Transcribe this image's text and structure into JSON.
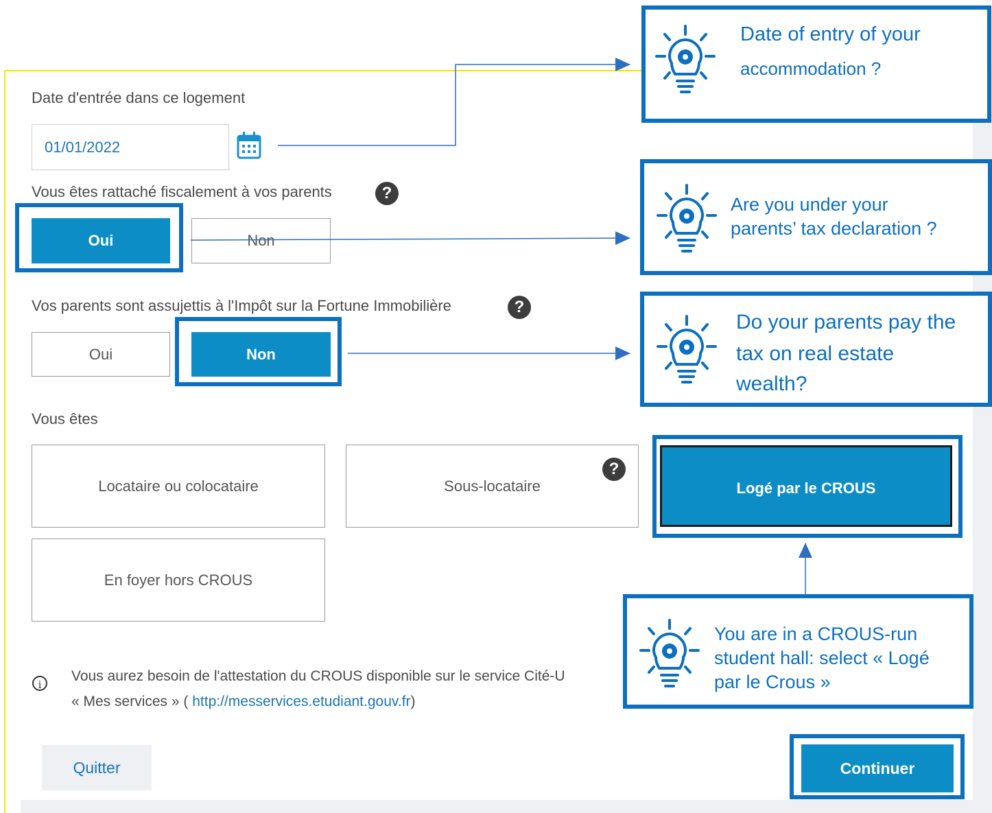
{
  "form": {
    "date_label": "Date d'entrée dans ce logement",
    "date_value": "01/01/2022",
    "tax_label": "Vous êtes rattaché fiscalement à vos parents",
    "tax_yes": "Oui",
    "tax_no": "Non",
    "ifi_label": "Vos parents sont assujettis à l'Impôt sur la Fortune Immobilière",
    "ifi_yes": "Oui",
    "ifi_no": "Non",
    "status_label": "Vous êtes",
    "status_options": [
      "Locataire ou colocataire",
      "Sous-locataire",
      "Logé par le CROUS",
      "En foyer hors CROUS"
    ],
    "help_glyph": "?",
    "info_glyph": "i",
    "info_text_1": "Vous aurez besoin de l'attestation du CROUS disponible sur le service Cité-U",
    "info_text_2_prefix": "« Mes services » (",
    "info_link": "http://messervices.etudiant.gouv.fr",
    "info_text_2_suffix": ")",
    "quit_label": "Quitter",
    "continue_label": "Continuer"
  },
  "callouts": {
    "date": [
      "Date of entry of your",
      "accommodation ?"
    ],
    "tax": [
      "Are you under your",
      "parents’ tax declaration ?"
    ],
    "ifi": [
      "Do your parents pay the",
      "tax on real estate",
      "wealth?"
    ],
    "crous": [
      "You are in a CROUS-run",
      "student hall: select « Logé",
      "par le Crous »"
    ]
  },
  "selected": {
    "tax": "Oui",
    "ifi": "Non",
    "status": "Logé par le CROUS"
  },
  "colors": {
    "primary_blue": "#0c8dc6",
    "annotation_blue": "#0c6fbf",
    "link_blue": "#1a75b5",
    "panel_border_yellow": "#f5e600"
  },
  "icons": {
    "calendar": "calendar-icon",
    "help": "question-circle-icon",
    "info": "info-circle-icon",
    "tip": "lightbulb-gear-icon"
  }
}
